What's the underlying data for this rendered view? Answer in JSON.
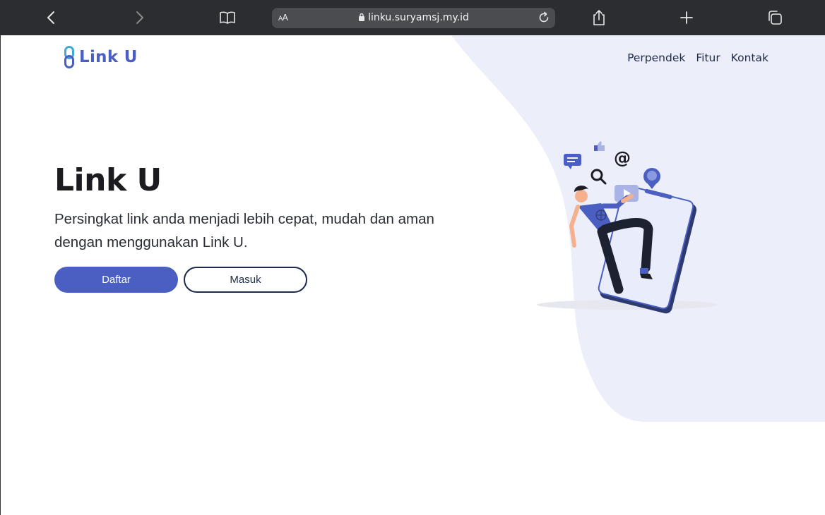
{
  "browser": {
    "url": "linku.suryamsj.my.id",
    "text_size_label": "AA"
  },
  "header": {
    "logo_text": "Link U",
    "nav": [
      "Perpendek",
      "Fitur",
      "Kontak"
    ]
  },
  "hero": {
    "title": "Link U",
    "description": "Persingkat link anda menjadi lebih cepat, mudah dan aman dengan menggunakan Link U.",
    "primary_button": "Daftar",
    "secondary_button": "Masuk"
  },
  "colors": {
    "brand": "#4a5fc1",
    "blob": "#eceefa",
    "toolbar": "#2b2d30"
  }
}
